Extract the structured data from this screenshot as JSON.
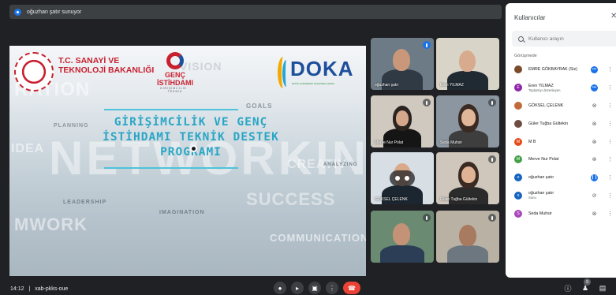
{
  "presenter_bar": {
    "text": "oğuzhan şatır sunuyor"
  },
  "slide": {
    "ministry_line1": "T.C. SANAYİ VE",
    "ministry_line2": "TEKNOLOJİ BAKANLIĞI",
    "genc_line1": "GENÇ",
    "genc_line2": "İSTİHDAMI",
    "genc_line3": "GİRİŞİMCİLİK · TEKNİK",
    "doka": "DOKA",
    "doka_sub": "DOĞU KARADENİZ KALKINMA AJANSI",
    "title_line1": "GİRİŞİMCİLİK VE GENÇ",
    "title_line2": "İSTİHDAMI TEKNİK DESTEK",
    "title_line3": "PROGRAMI",
    "watermarks": {
      "vision": "VISION",
      "ration": "RATION",
      "planning": "PLANNING",
      "idea": "IDEA",
      "networking": "NETWORKING",
      "leadership": "LEADERSHIP",
      "mwork": "MWORK",
      "imagination": "IMAGINATION",
      "success": "SUCCESS",
      "communication": "COMMUNICATION",
      "creative": "CREATIV",
      "analyzing": "ANALYZING",
      "goals": "GOALS"
    }
  },
  "tiles": [
    {
      "name": "oğuzhan şatır",
      "speaking": true
    },
    {
      "name": "Eren YILMAZ",
      "speaking": false
    },
    {
      "name": "Merve Nur Polat",
      "speaking": false
    },
    {
      "name": "Seda Muhsir",
      "speaking": false
    },
    {
      "name": "GÖKSEL ÇELENK",
      "speaking": false
    },
    {
      "name": "Güler Tuğba Gültekin",
      "speaking": false
    },
    {
      "name": "",
      "speaking": false
    },
    {
      "name": "",
      "speaking": false
    }
  ],
  "bottom": {
    "time": "14:12",
    "separator": "|",
    "meeting_code": "xab-pkks-oue",
    "participant_count": "9"
  },
  "panel": {
    "title": "Kullanıcılar",
    "search_placeholder": "Kullanıcı arayın",
    "section": "Görüşmede",
    "participants": [
      {
        "initial": "",
        "name": "EMRE GÖKBAYRAK (Siz)",
        "sub": "",
        "color": "#7b4b2a",
        "mic": "dots"
      },
      {
        "initial": "E",
        "name": "Eren YILMAZ",
        "sub": "Toplantıyı düzenleyen",
        "color": "#8e24aa",
        "mic": "dots"
      },
      {
        "initial": "",
        "name": "GÖKSEL ÇELENK",
        "sub": "",
        "color": "#c26a3a",
        "mic": "muted"
      },
      {
        "initial": "",
        "name": "Güler Tuğba Gültekin",
        "sub": "",
        "color": "#6d4c41",
        "mic": "muted"
      },
      {
        "initial": "M",
        "name": "M B",
        "sub": "",
        "color": "#e64a19",
        "mic": "muted"
      },
      {
        "initial": "M",
        "name": "Merve Nur Polat",
        "sub": "",
        "color": "#43a047",
        "mic": "muted"
      },
      {
        "initial": "o",
        "name": "oğuzhan şatır",
        "sub": "",
        "color": "#1565c0",
        "mic": "speaking"
      },
      {
        "initial": "o",
        "name": "oğuzhan şatır",
        "sub": "Sunu",
        "color": "#1565c0",
        "mic": "off"
      },
      {
        "initial": "S",
        "name": "Seda Muhsir",
        "sub": "",
        "color": "#ab47bc",
        "mic": "muted"
      }
    ]
  },
  "colors": {
    "accent": "#1a73e8",
    "end_call": "#ea4335",
    "slide_title": "#2aa6c4",
    "ministry_red": "#c8202f"
  }
}
